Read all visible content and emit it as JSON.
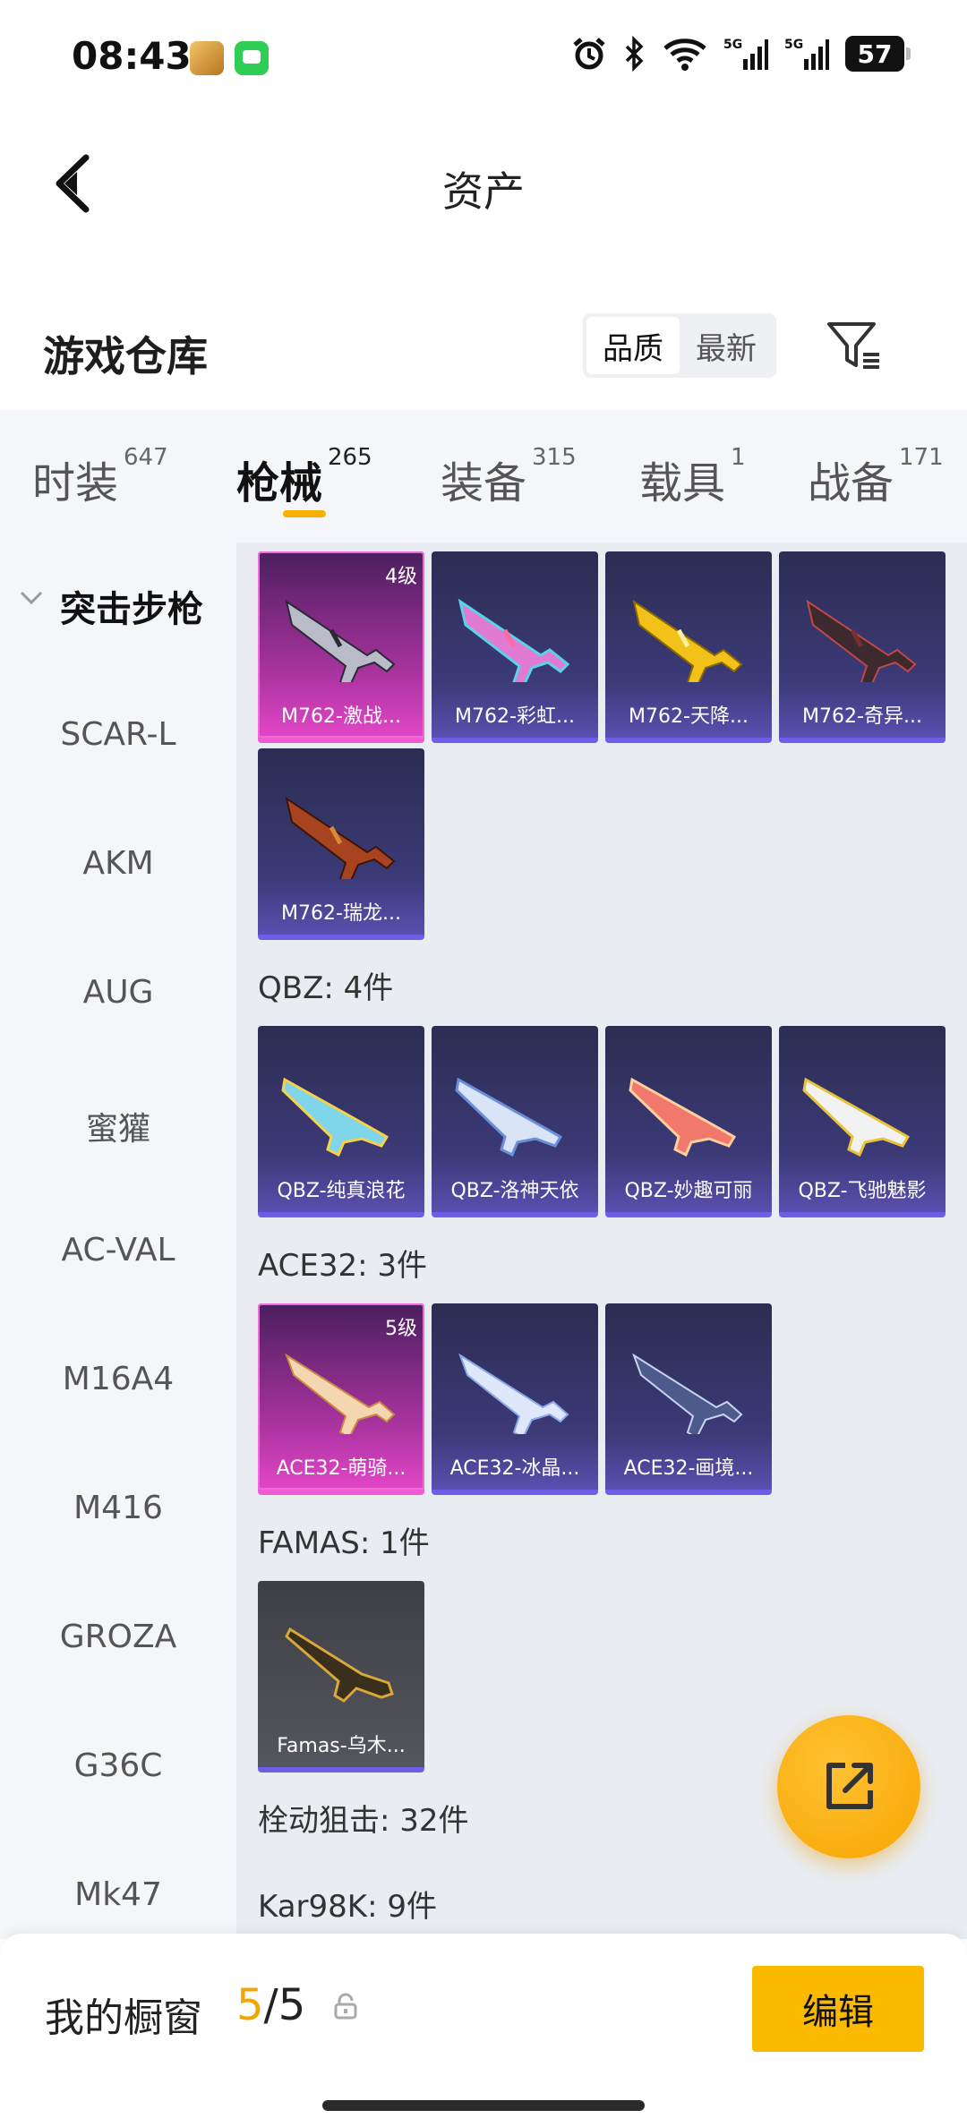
{
  "status": {
    "time": "08:43",
    "battery": "57"
  },
  "nav": {
    "title": "资产"
  },
  "warehouse": {
    "title": "游戏仓库",
    "sort_options": [
      "品质",
      "最新"
    ],
    "active_sort": "品质"
  },
  "tabs": [
    {
      "label": "时装",
      "count": "647"
    },
    {
      "label": "枪械",
      "count": "265"
    },
    {
      "label": "装备",
      "count": "315"
    },
    {
      "label": "载具",
      "count": "1"
    },
    {
      "label": "战备",
      "count": "171"
    }
  ],
  "active_tab": "枪械",
  "sidebar": {
    "items": [
      "突击步枪",
      "SCAR-L",
      "AKM",
      "AUG",
      "蜜獾",
      "AC-VAL",
      "M16A4",
      "M416",
      "GROZA",
      "G36C",
      "Mk47"
    ],
    "active": "突击步枪"
  },
  "groups": [
    {
      "title": "",
      "items": [
        {
          "name": "M762-激战...",
          "level": "4级",
          "style": "pink"
        },
        {
          "name": "M762-彩虹...",
          "level": "",
          "style": "purple"
        },
        {
          "name": "M762-天降...",
          "level": "",
          "style": "purple"
        },
        {
          "name": "M762-奇异...",
          "level": "",
          "style": "purple"
        },
        {
          "name": "M762-瑞龙...",
          "level": "",
          "style": "purple"
        }
      ]
    },
    {
      "title": "QBZ: 4件",
      "items": [
        {
          "name": "QBZ-纯真浪花",
          "level": "",
          "style": "purple"
        },
        {
          "name": "QBZ-洛神天依",
          "level": "",
          "style": "purple"
        },
        {
          "name": "QBZ-妙趣可丽",
          "level": "",
          "style": "purple"
        },
        {
          "name": "QBZ-飞驰魅影",
          "level": "",
          "style": "purple"
        }
      ]
    },
    {
      "title": "ACE32: 3件",
      "items": [
        {
          "name": "ACE32-萌骑...",
          "level": "5级",
          "style": "pink"
        },
        {
          "name": "ACE32-冰晶...",
          "level": "",
          "style": "purple"
        },
        {
          "name": "ACE32-画境...",
          "level": "",
          "style": "purple"
        }
      ]
    },
    {
      "title": "FAMAS: 1件",
      "items": [
        {
          "name": "Famas-乌木...",
          "level": "",
          "style": "gray"
        }
      ]
    },
    {
      "title": "栓动狙击: 32件",
      "items": []
    },
    {
      "title": "Kar98K: 9件",
      "items": []
    }
  ],
  "bottom": {
    "label": "我的橱窗",
    "count_current": "5",
    "count_sep": "/",
    "count_total": "5",
    "edit_label": "编辑"
  },
  "icons": [
    "back-arrow-icon",
    "filter-icon",
    "chevron-down-icon",
    "share-icon",
    "lock-icon",
    "alarm-icon",
    "bluetooth-icon",
    "wifi-icon",
    "signal-icon"
  ],
  "colors": {
    "accent": "#fbb900",
    "card_purple": "#3c3a78",
    "card_pink": "#e246c7"
  }
}
